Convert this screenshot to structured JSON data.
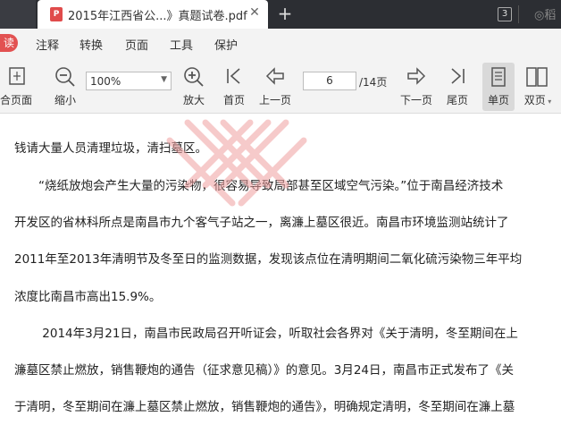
{
  "tabs": {
    "active_title": "2015年江西省公...》真题试卷.pdf",
    "active_icon": "pdf-icon",
    "tab_count": "3",
    "user_text": "稻"
  },
  "menu": {
    "read": "读",
    "items": [
      "注释",
      "转换",
      "页面",
      "工具",
      "保护"
    ]
  },
  "toolbar": {
    "fit_page": "合页面",
    "zoom_out": "缩小",
    "zoom_value": "100%",
    "zoom_in": "放大",
    "first_page": "首页",
    "prev_page": "上一页",
    "current_page": "6",
    "total_pages": "/14页",
    "next_page": "下一页",
    "last_page": "尾页",
    "single_page": "单页",
    "double_page": "双页"
  },
  "document": {
    "lines": [
      "钱请大量人员清理垃圾，清扫墓区。",
      "　　“烧纸放炮会产生大量的污染物，很容易导致局部甚至区域空气污染。”位于南昌经济技术",
      "开发区的省林科所点是南昌市九个客气子站之一，离濂上墓区很近。南昌市环境监测站统计了",
      "2011年至2013年清明节及冬至日的监测数据，发现该点位在清明期间二氧化硫污染物三年平均",
      "浓度比南昌市高出15.9%。",
      "　　 2014年3月21日，南昌市民政局召开听证会，听取社会各界对《关于清明，冬至期间在上",
      "濂墓区禁止燃放，销售鞭炮的通告（征求意见稿）》的意见。3月24日，南昌市正式发布了《关",
      "于清明，冬至期间在濂上墓区禁止燃放，销售鞭炮的通告》，明确规定清明，冬至期间在濂上墓"
    ]
  },
  "colors": {
    "tabbar_bg": "#2c2e33",
    "accent_red": "#e25151",
    "toolbar_bg": "#f3f3f3"
  }
}
